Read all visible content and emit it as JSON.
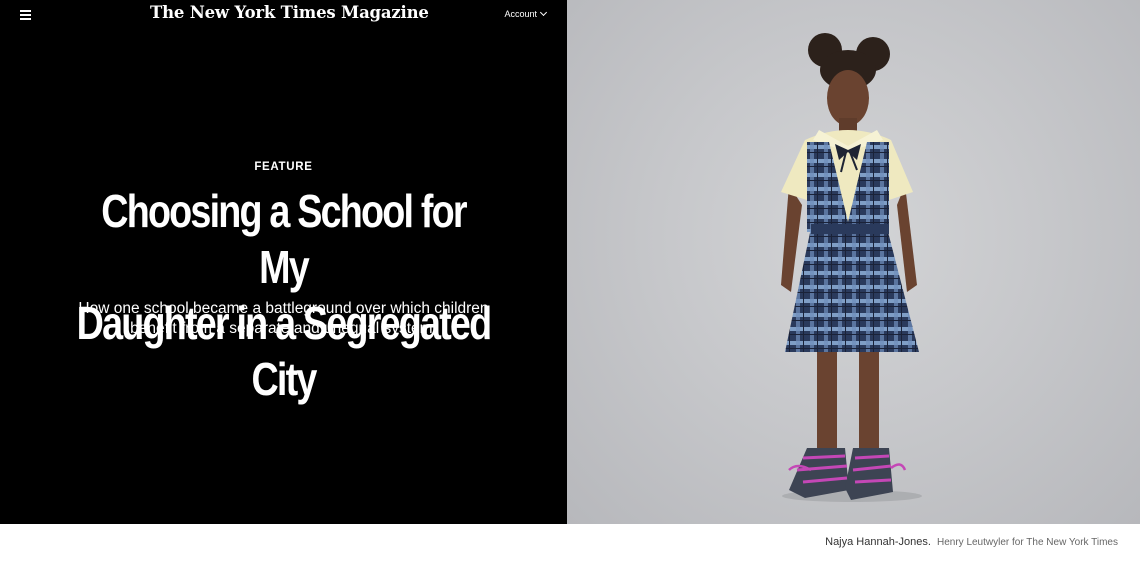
{
  "header": {
    "masthead": "The New York Times Magazine",
    "account_label": "Account"
  },
  "article": {
    "kicker": "FEATURE",
    "headline_line1": "Choosing a School for My",
    "headline_line2": "Daughter in a Segregated City",
    "dek": "How one school became a battleground over which children benefit from a separate and unequal system."
  },
  "photo": {
    "caption": "Najya Hannah-Jones.",
    "credit": "Henry Leutwyler for The New York Times",
    "colors": {
      "backdrop": "#c7c8cb",
      "plaid": "#2a3a5c",
      "blouse": "#efe9c0",
      "shoes": "#c447b6"
    }
  }
}
